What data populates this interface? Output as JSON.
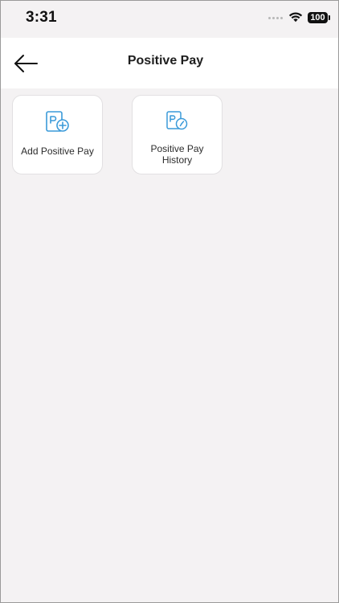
{
  "status_bar": {
    "time": "3:31",
    "battery": "100"
  },
  "header": {
    "title": "Positive Pay",
    "back_icon": "back-arrow-icon"
  },
  "tiles": [
    {
      "label": "Add Positive Pay",
      "icon": "check-add-icon"
    },
    {
      "label": "Positive Pay History",
      "icon": "check-history-icon"
    }
  ],
  "colors": {
    "accent": "#3a9ad9",
    "background": "#f4f2f3",
    "surface": "#ffffff"
  }
}
